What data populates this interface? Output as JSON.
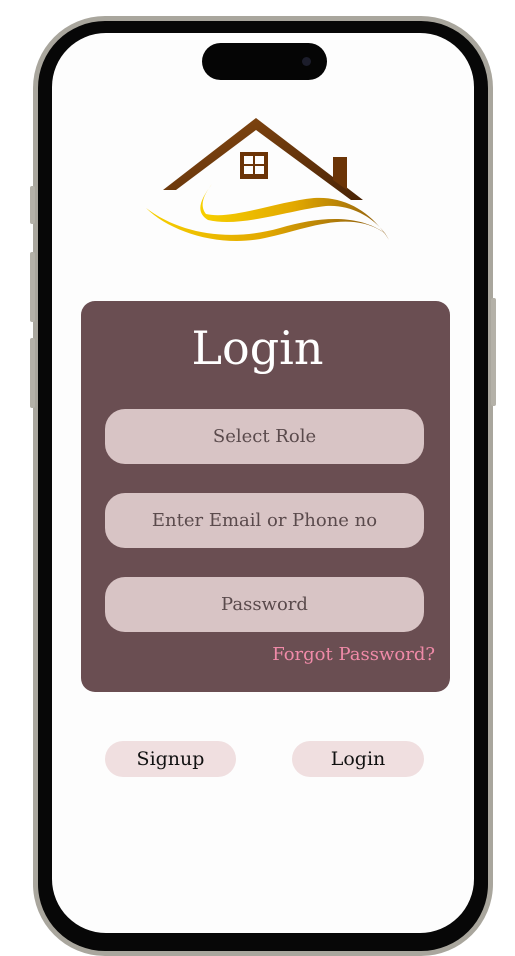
{
  "login_card": {
    "title": "Login",
    "role_placeholder": "Select Role",
    "email_placeholder": "Enter Email or Phone no",
    "password_placeholder": "Password",
    "forgot_password": "Forgot Password?"
  },
  "actions": {
    "signup_label": "Signup",
    "login_label": "Login"
  },
  "colors": {
    "card_background": "#6a4e52",
    "field_background": "#d8c4c5",
    "forgot_link": "#f08aa8",
    "button_background": "#f0dfe0",
    "logo_roof": "#6b3a0e",
    "logo_swoosh": "#e6b800"
  },
  "icons": [
    "house-logo-icon"
  ]
}
